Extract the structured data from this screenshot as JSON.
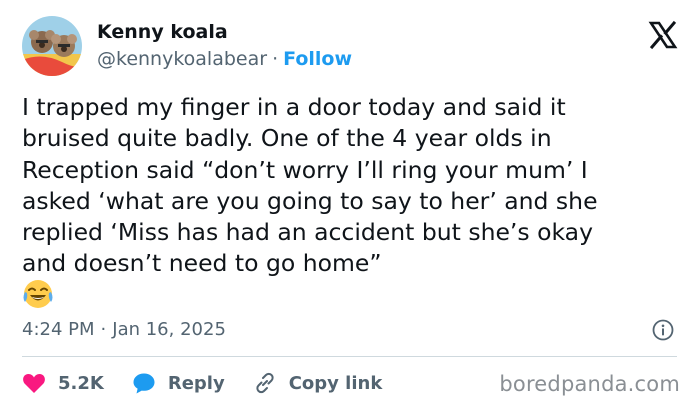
{
  "author": {
    "name": "Kenny koala",
    "handle": "@kennykoalabear",
    "separator": "·",
    "follow_label": "Follow"
  },
  "tweet": {
    "text": "I trapped my finger in a door today and said it\nbruised quite badly. One of the 4 year olds in\nReception said “don’t worry I’ll ring your mum’ I\nasked ‘what are you going to say to her’ and she\nreplied ‘Miss has had an accident but she’s okay\nand doesn’t need to go home”",
    "emoji": "face-with-tears-of-joy"
  },
  "meta": {
    "time": "4:24 PM",
    "separator": "·",
    "date": "Jan 16, 2025"
  },
  "actions": {
    "likes": "5.2K",
    "reply_label": "Reply",
    "copy_link_label": "Copy link"
  },
  "watermark": "boredpanda.com",
  "colors": {
    "accent": "#1d9bf0",
    "like": "#f91880",
    "secondary_text": "#536471",
    "primary_text": "#0f1419"
  }
}
